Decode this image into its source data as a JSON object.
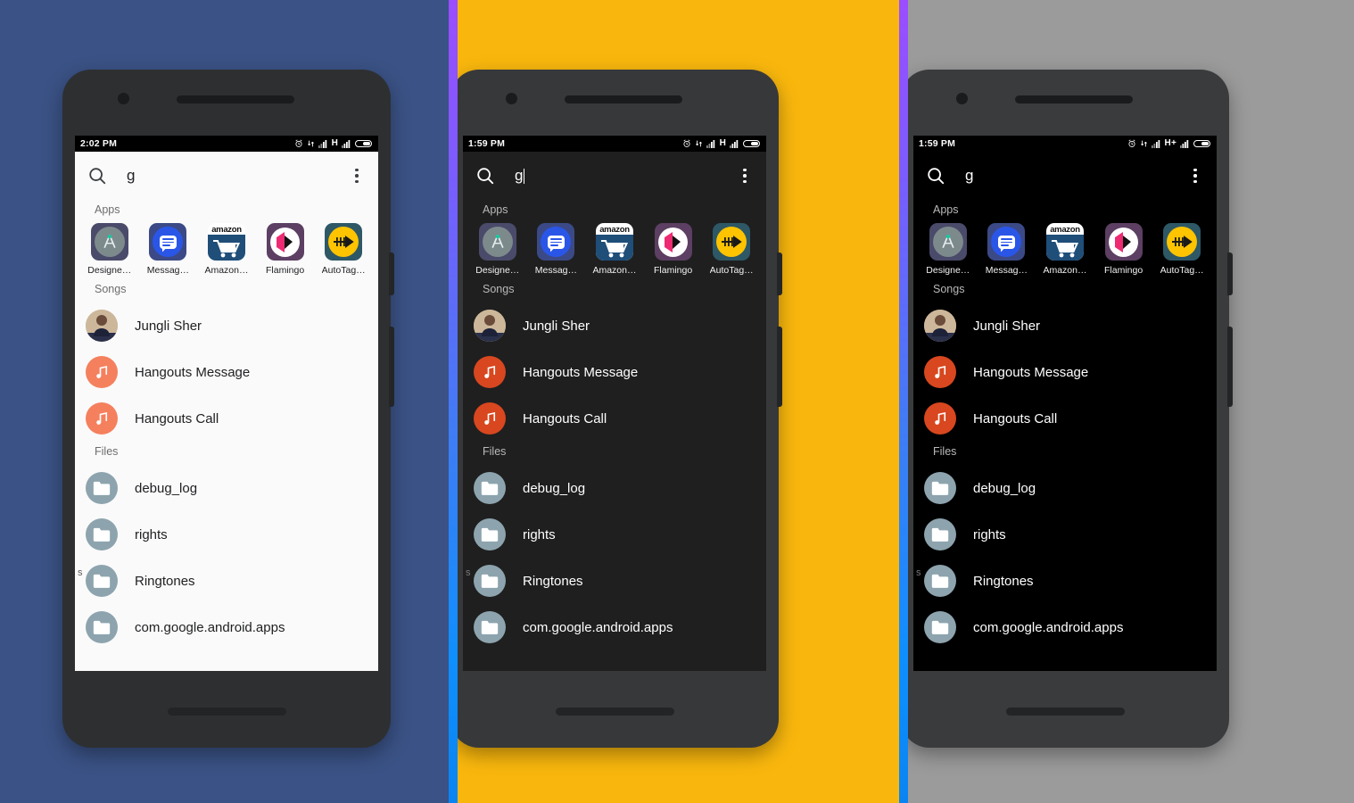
{
  "canvas": {
    "panels": [
      {
        "name": "panel-light-theme",
        "bg": "#3a5285"
      },
      {
        "name": "panel-dark-theme",
        "bg": "#f9b70d"
      },
      {
        "name": "panel-amoled-theme",
        "bg": "#9b9b9b"
      }
    ],
    "divider_gradient_top": "#9b4dff",
    "divider_gradient_bottom": "#0a84f2"
  },
  "phones": [
    {
      "id": "phone-light",
      "theme": "light",
      "status_bar": {
        "time": "2:02 PM",
        "network": "H",
        "icons": [
          "alarm-icon",
          "vibrate-icon",
          "signal-bars-icon",
          "network-label",
          "signal-bars-icon",
          "battery-icon"
        ]
      },
      "search": {
        "query": "g",
        "placeholder": "Search",
        "caret": false
      }
    },
    {
      "id": "phone-dark",
      "theme": "dark",
      "status_bar": {
        "time": "1:59 PM",
        "network": "H",
        "icons": [
          "alarm-icon",
          "vibrate-icon",
          "signal-bars-icon",
          "network-label",
          "signal-bars-icon",
          "battery-icon"
        ]
      },
      "search": {
        "query": "g",
        "placeholder": "Search",
        "caret": true
      }
    },
    {
      "id": "phone-amoled",
      "theme": "amoled",
      "status_bar": {
        "time": "1:59 PM",
        "network": "H+",
        "icons": [
          "alarm-icon",
          "vibrate-icon",
          "signal-bars-icon",
          "network-label",
          "signal-bars-icon",
          "battery-icon"
        ]
      },
      "search": {
        "query": "g",
        "placeholder": "Search",
        "caret": false
      }
    }
  ],
  "content": {
    "sections": {
      "apps": "Apps",
      "songs": "Songs",
      "files": "Files"
    },
    "apps": [
      {
        "label": "Designe…",
        "icon": "designer-tools-icon"
      },
      {
        "label": "Messag…",
        "icon": "messages-icon"
      },
      {
        "label": "Amazon…",
        "icon": "amazon-shopping-icon",
        "wordmark": "amazon"
      },
      {
        "label": "Flamingo",
        "icon": "flamingo-icon"
      },
      {
        "label": "AutoTag…",
        "icon": "autotag-trumpet-icon"
      }
    ],
    "songs": [
      {
        "title": "Jungli Sher",
        "icon": "album-art"
      },
      {
        "title": "Hangouts Message",
        "icon": "music-note-icon"
      },
      {
        "title": "Hangouts Call",
        "icon": "music-note-icon"
      }
    ],
    "files": [
      {
        "name": "debug_log",
        "icon": "folder-icon"
      },
      {
        "name": "rights",
        "icon": "folder-icon"
      },
      {
        "name": "Ringtones",
        "icon": "folder-icon"
      },
      {
        "name": "com.google.android.apps",
        "icon": "folder-icon"
      }
    ],
    "edge_glyph": "s",
    "overflow_menu": "kebab-menu-icon",
    "search_icon": "search-icon"
  },
  "colors": {
    "light_bg": "#fafafa",
    "dark_bg": "#1f1f1f",
    "amoled_bg": "#000000",
    "music_accent_light": "#f5805e",
    "music_accent_dark": "#d8471f",
    "folder_accent": "#8da4ae"
  }
}
